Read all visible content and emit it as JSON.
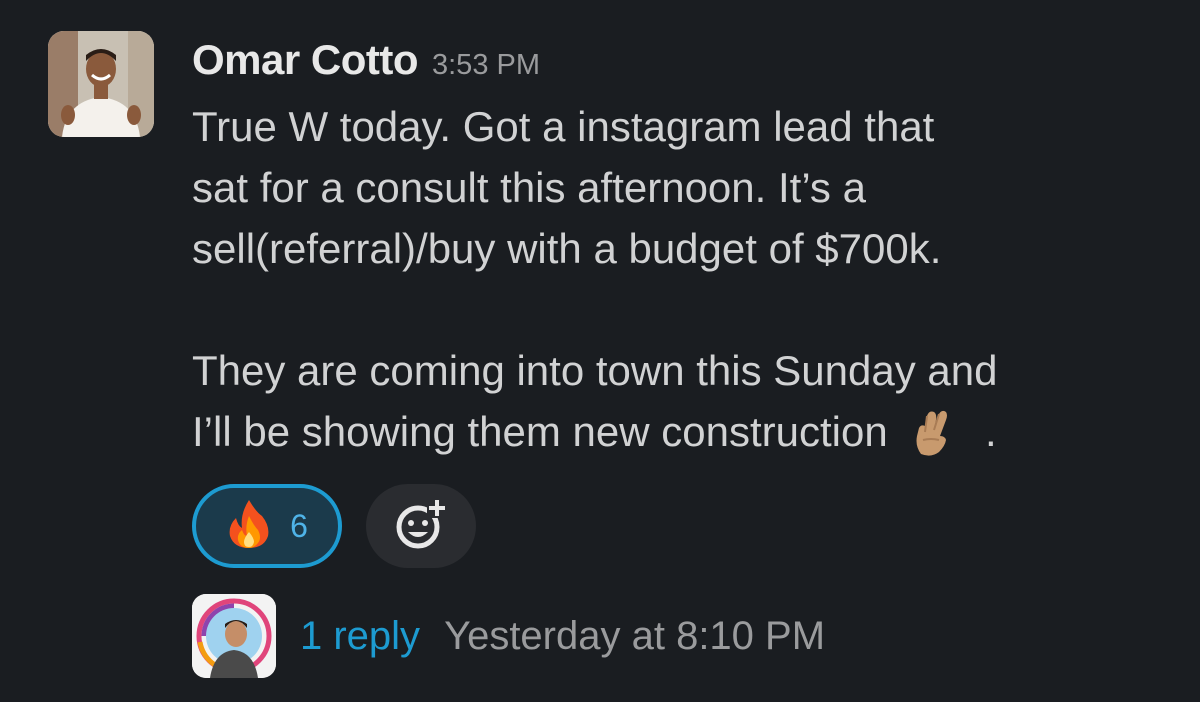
{
  "message": {
    "author": "Omar Cotto",
    "timestamp": "3:53 PM",
    "paragraph1": [
      "True W today. Got a instagram lead that",
      "sat for a consult this afternoon. It’s a",
      "sell(referral)/buy with a budget of $700k."
    ],
    "paragraph2": [
      "They are coming into town this Sunday and",
      "I’ll be showing them new construction",
      "."
    ]
  },
  "reactions": [
    {
      "emoji": "fire-emoji",
      "count": "6"
    }
  ],
  "add_reaction": {
    "icon": "add-emoji-icon"
  },
  "thread": {
    "reply_count_label": "1 reply",
    "last_reply_time": "Yesterday at 8:10 PM"
  },
  "colors": {
    "background": "#1a1d21",
    "accent": "#1d9bd1",
    "text": "#d1d2d3",
    "muted": "#9a9b9d"
  }
}
